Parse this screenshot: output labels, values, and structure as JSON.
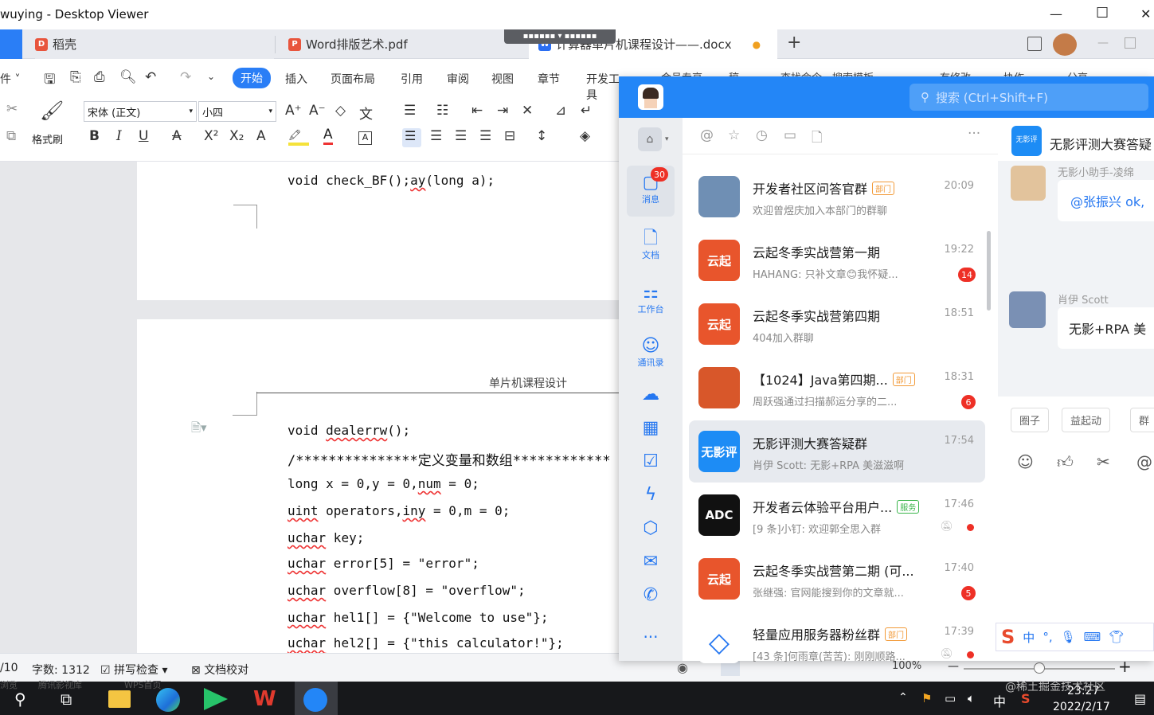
{
  "window": {
    "title": "wuying - Desktop Viewer",
    "minimize": "—",
    "maximize": "☐",
    "close": "✕"
  },
  "tabs": [
    {
      "label": "稻壳",
      "color": "#e8553d",
      "glyph": "D"
    },
    {
      "label": "Word排版艺术.pdf",
      "color": "#e8553d",
      "glyph": "P"
    },
    {
      "label": "计算器单片机课程设计——.docx",
      "color": "#2b6ef2",
      "glyph": "W"
    }
  ],
  "tab_add": "+",
  "remote_toolbar": "▪▪▪▪▪▪  ▾  ▪▪▪▪▪▪",
  "ribbon": {
    "file_menu": "件",
    "menu": [
      "开始",
      "插入",
      "页面布局",
      "引用",
      "审阅",
      "视图",
      "章节",
      "开发工具",
      "会员专享",
      "稿"
    ],
    "format_painter": "格式刷",
    "font_name": "宋体 (正文)",
    "font_size": "小四",
    "right_menu": [
      "查找命令、搜索模板",
      "有修改",
      "协作",
      "分享"
    ]
  },
  "document": {
    "page1_line": "void check_BF();",
    "page1_line_sq": "ay",
    "page1_line_tail": "(long a);",
    "header_text": "单片机课程设计",
    "lines": [
      [
        "void ",
        "dealerrw",
        "();"
      ],
      [
        "/***************定义变量和数组************",
        "",
        ""
      ],
      [
        "long x = 0,y = 0,",
        "num",
        " = 0;"
      ],
      [
        "",
        "uint",
        " operators,"
      ],
      [
        "",
        "uchar",
        " key;"
      ],
      [
        "",
        "uchar",
        " error[5] = \"error\";"
      ],
      [
        "",
        "uchar",
        " overflow[8] = \"overflow\";"
      ],
      [
        "",
        "uchar",
        " hel1[] = {\"Welcome to use\"};"
      ],
      [
        "",
        "uchar",
        " hel2[] = {\"this calculator!\"};"
      ]
    ],
    "line3_extra_sq": "iny",
    "line3_extra_tail": " = 0,m = 0;"
  },
  "status": {
    "page": "/10",
    "words": "字数: 1312",
    "spell": "拼写检查",
    "proof": "文档校对",
    "zoom": "100%",
    "minus": "—",
    "plus": "+"
  },
  "taskbar": {
    "time": "23:27",
    "date": "2022/2/17",
    "ime": "中",
    "watermark": "@稀土掘金技术社区",
    "left_labels": [
      "浏览",
      "腾讯影视库",
      "WPS首页"
    ]
  },
  "chat": {
    "search_placeholder": "搜索 (Ctrl+Shift+F)",
    "nav": [
      {
        "icon": "message-icon",
        "label": "消息",
        "badge": "30",
        "glyph": "💬"
      },
      {
        "icon": "document-icon",
        "label": "文档",
        "glyph": "📄"
      },
      {
        "icon": "workbench-icon",
        "label": "工作台",
        "glyph": "⚏"
      },
      {
        "icon": "contacts-icon",
        "label": "通讯录",
        "glyph": "👤"
      }
    ],
    "more": "···",
    "conversations": [
      {
        "name": "开发者社区问答官群",
        "tag": "部门",
        "tag_color": "#f29a38",
        "time": "20:09",
        "msg": "欢迎曾煜庆加入本部门的群聊",
        "avatar_text": "",
        "avatar_color": "#6f8fb4"
      },
      {
        "name": "云起冬季实战营第一期",
        "tag": "",
        "time": "19:22",
        "msg": "HAHANG: 只补文章😊我怀疑...",
        "avatar_text": "云起",
        "avatar_color": "#e8552c",
        "badge": "14"
      },
      {
        "name": "云起冬季实战营第四期",
        "tag": "",
        "time": "18:51",
        "msg": "404加入群聊",
        "avatar_text": "云起",
        "avatar_color": "#e8552c"
      },
      {
        "name": "【1024】Java第四期...",
        "tag": "部门",
        "tag_color": "#f29a38",
        "time": "18:31",
        "msg": "周跃强通过扫描郝运分享的二...",
        "avatar_text": "",
        "avatar_color": "#d8572a",
        "badge": "6"
      },
      {
        "name": "无影评测大赛答疑群",
        "tag": "",
        "time": "17:54",
        "msg": "肖伊 Scott: 无影+RPA 美滋滋啊",
        "avatar_text": "无影评",
        "avatar_color": "#1d8cf5",
        "selected": true
      },
      {
        "name": "开发者云体验平台用户...",
        "tag": "服务",
        "tag_color": "#39b54a",
        "time": "17:46",
        "msg": "[9 条]小钉: 欢迎郭全思入群",
        "avatar_text": "ADC",
        "avatar_color": "#111111",
        "dot": true
      },
      {
        "name": "云起冬季实战营第二期 (可...",
        "tag": "",
        "time": "17:40",
        "msg": "张继强: 官网能搜到你的文章就...",
        "avatar_text": "云起",
        "avatar_color": "#e8552c",
        "badge": "5"
      },
      {
        "name": "轻量应用服务器粉丝群",
        "tag": "部门",
        "tag_color": "#f29a38",
        "time": "17:39",
        "msg": "[43 条]何雨章(苦苦): 刚刚顺路...",
        "avatar_text": "◇",
        "avatar_color": "#ffffff",
        "dot": true
      }
    ],
    "right": {
      "title": "无影评测大赛答疑",
      "msg1_sender": "无影小助手-凌绵",
      "msg1_text": "@张振兴 ok,",
      "msg2_sender": "肖伊 Scott",
      "msg2_text": "无影+RPA 美",
      "chips": [
        "圈子",
        "益起动",
        "群"
      ]
    }
  }
}
